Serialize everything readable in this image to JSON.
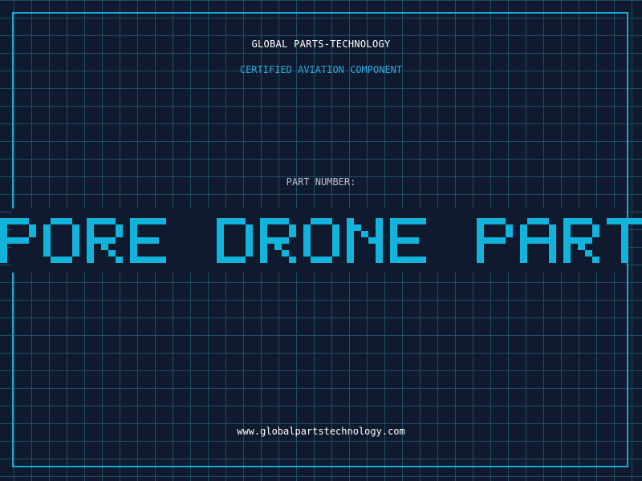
{
  "header": {
    "company_name": "GLOBAL PARTS-TECHNOLOGY",
    "tagline": "CERTIFIED AVIATION COMPONENT"
  },
  "part": {
    "label": "PART NUMBER:",
    "number": "SPORE DRONE PARTS"
  },
  "footer": {
    "url": "www.globalpartstechnology.com"
  },
  "colors": {
    "background": "#101a2e",
    "grid": "#1d4e66",
    "accent": "#18a9d4",
    "part_text": "#12b4dc"
  }
}
